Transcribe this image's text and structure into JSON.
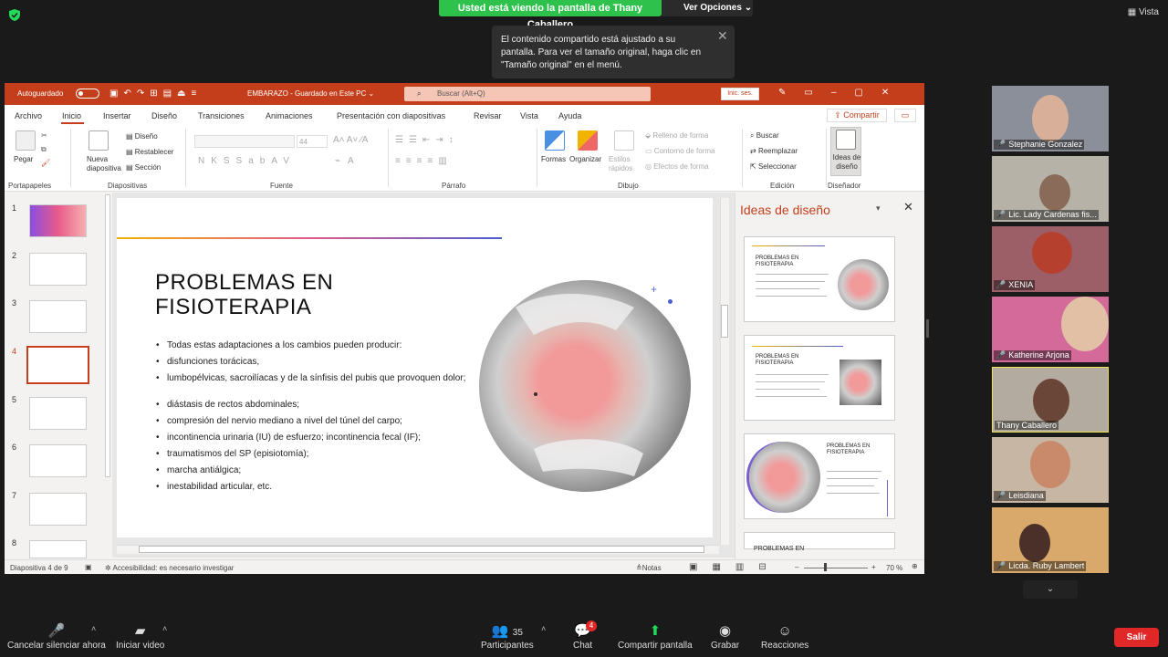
{
  "zoom": {
    "share_banner": "Usted está viendo la pantalla de Thany Caballero",
    "view_options": "Ver Opciones",
    "view_label": "Vista",
    "tooltip": "El contenido compartido está ajustado a su pantalla. Para ver el tamaño original, haga clic en \"Tamaño original\" en el menú.",
    "participants_count": "35",
    "chat_badge": "4",
    "toolbar": {
      "unmute": "Cancelar silenciar ahora",
      "video": "Iniciar video",
      "participants": "Participantes",
      "chat": "Chat",
      "share": "Compartir pantalla",
      "record": "Grabar",
      "reactions": "Reacciones",
      "leave": "Salir"
    },
    "tiles": [
      {
        "name": "Stephanie Gonzalez",
        "bg": "#8a8f9a"
      },
      {
        "name": "Lic. Lady Cardenas fis...",
        "bg": "#b7b2a8"
      },
      {
        "name": "XENIA",
        "bg": "#9c5f68"
      },
      {
        "name": "Katherine Arjona",
        "bg": "#d46a9a"
      },
      {
        "name": "Thany Caballero",
        "bg": "#b3aba0"
      },
      {
        "name": "Leisdiana",
        "bg": "#c8b6a4"
      },
      {
        "name": "Licda. Ruby Lambert",
        "bg": "#d9a96b"
      }
    ]
  },
  "ppt": {
    "autosave": "Autoguardado",
    "doc_title": "EMBARAZO  -  Guardado en Este PC  ⌄",
    "search_placeholder": "Buscar (Alt+Q)",
    "signin": "Inic. ses.",
    "tabs": [
      "Archivo",
      "Inicio",
      "Insertar",
      "Diseño",
      "Transiciones",
      "Animaciones",
      "Presentación con diapositivas",
      "Revisar",
      "Vista",
      "Ayuda"
    ],
    "share": "Compartir",
    "ribbon": {
      "paste": "Pegar",
      "new_slide": "Nueva diapositiva",
      "layout": "Diseño",
      "reset": "Restablecer",
      "section": "Sección",
      "font_size": "44",
      "shapes": "Formas",
      "arrange": "Organizar",
      "quick_styles": "Estilos rápidos",
      "shape_fill": "Relleno de forma",
      "shape_outline": "Contorno de forma",
      "shape_effects": "Efectos de forma",
      "find": "Buscar",
      "replace": "Reemplazar",
      "select": "Seleccionar",
      "design_ideas": "Ideas de diseño",
      "groups": [
        "Portapapeles",
        "Diapositivas",
        "Fuente",
        "Párrafo",
        "Dibujo",
        "Edición",
        "Diseñador"
      ]
    },
    "slide_numbers": [
      "1",
      "2",
      "3",
      "4",
      "5",
      "6",
      "7",
      "8"
    ],
    "active_slide": 4,
    "slide": {
      "title_line1": "PROBLEMAS EN",
      "title_line2": "FISIOTERAPIA",
      "bullets": [
        "Todas estas adaptaciones a los cambios pueden producir:",
        "disfunciones torácicas,",
        "lumbopélvicas, sacroilíacas y de la sínfisis del pubis que provoquen dolor;",
        " diástasis de rectos abdominales;",
        "compresión del nervio mediano a nivel del túnel del carpo;",
        "incontinencia urinaria (IU) de esfuerzo; incontinencia fecal (IF);",
        " traumatismos del SP (episiotomía);",
        " marcha antiálgica;",
        " inestabilidad articular, etc."
      ]
    },
    "design_pane": {
      "title": "Ideas de diseño",
      "idea_title_a": "PROBLEMAS EN FISIOTERAPIA",
      "idea_title_b": "PROBLEMAS EN FISIOTERAPIA",
      "idea_title_c": "PROBLEMAS EN FISIOTERAPIA",
      "idea_title_d": "PROBLEMAS EN"
    },
    "status": {
      "slide_of": "Diapositiva 4 de 9",
      "accessibility": "Accesibilidad: es necesario investigar",
      "notes": "Notas",
      "zoom": "70 %"
    }
  }
}
